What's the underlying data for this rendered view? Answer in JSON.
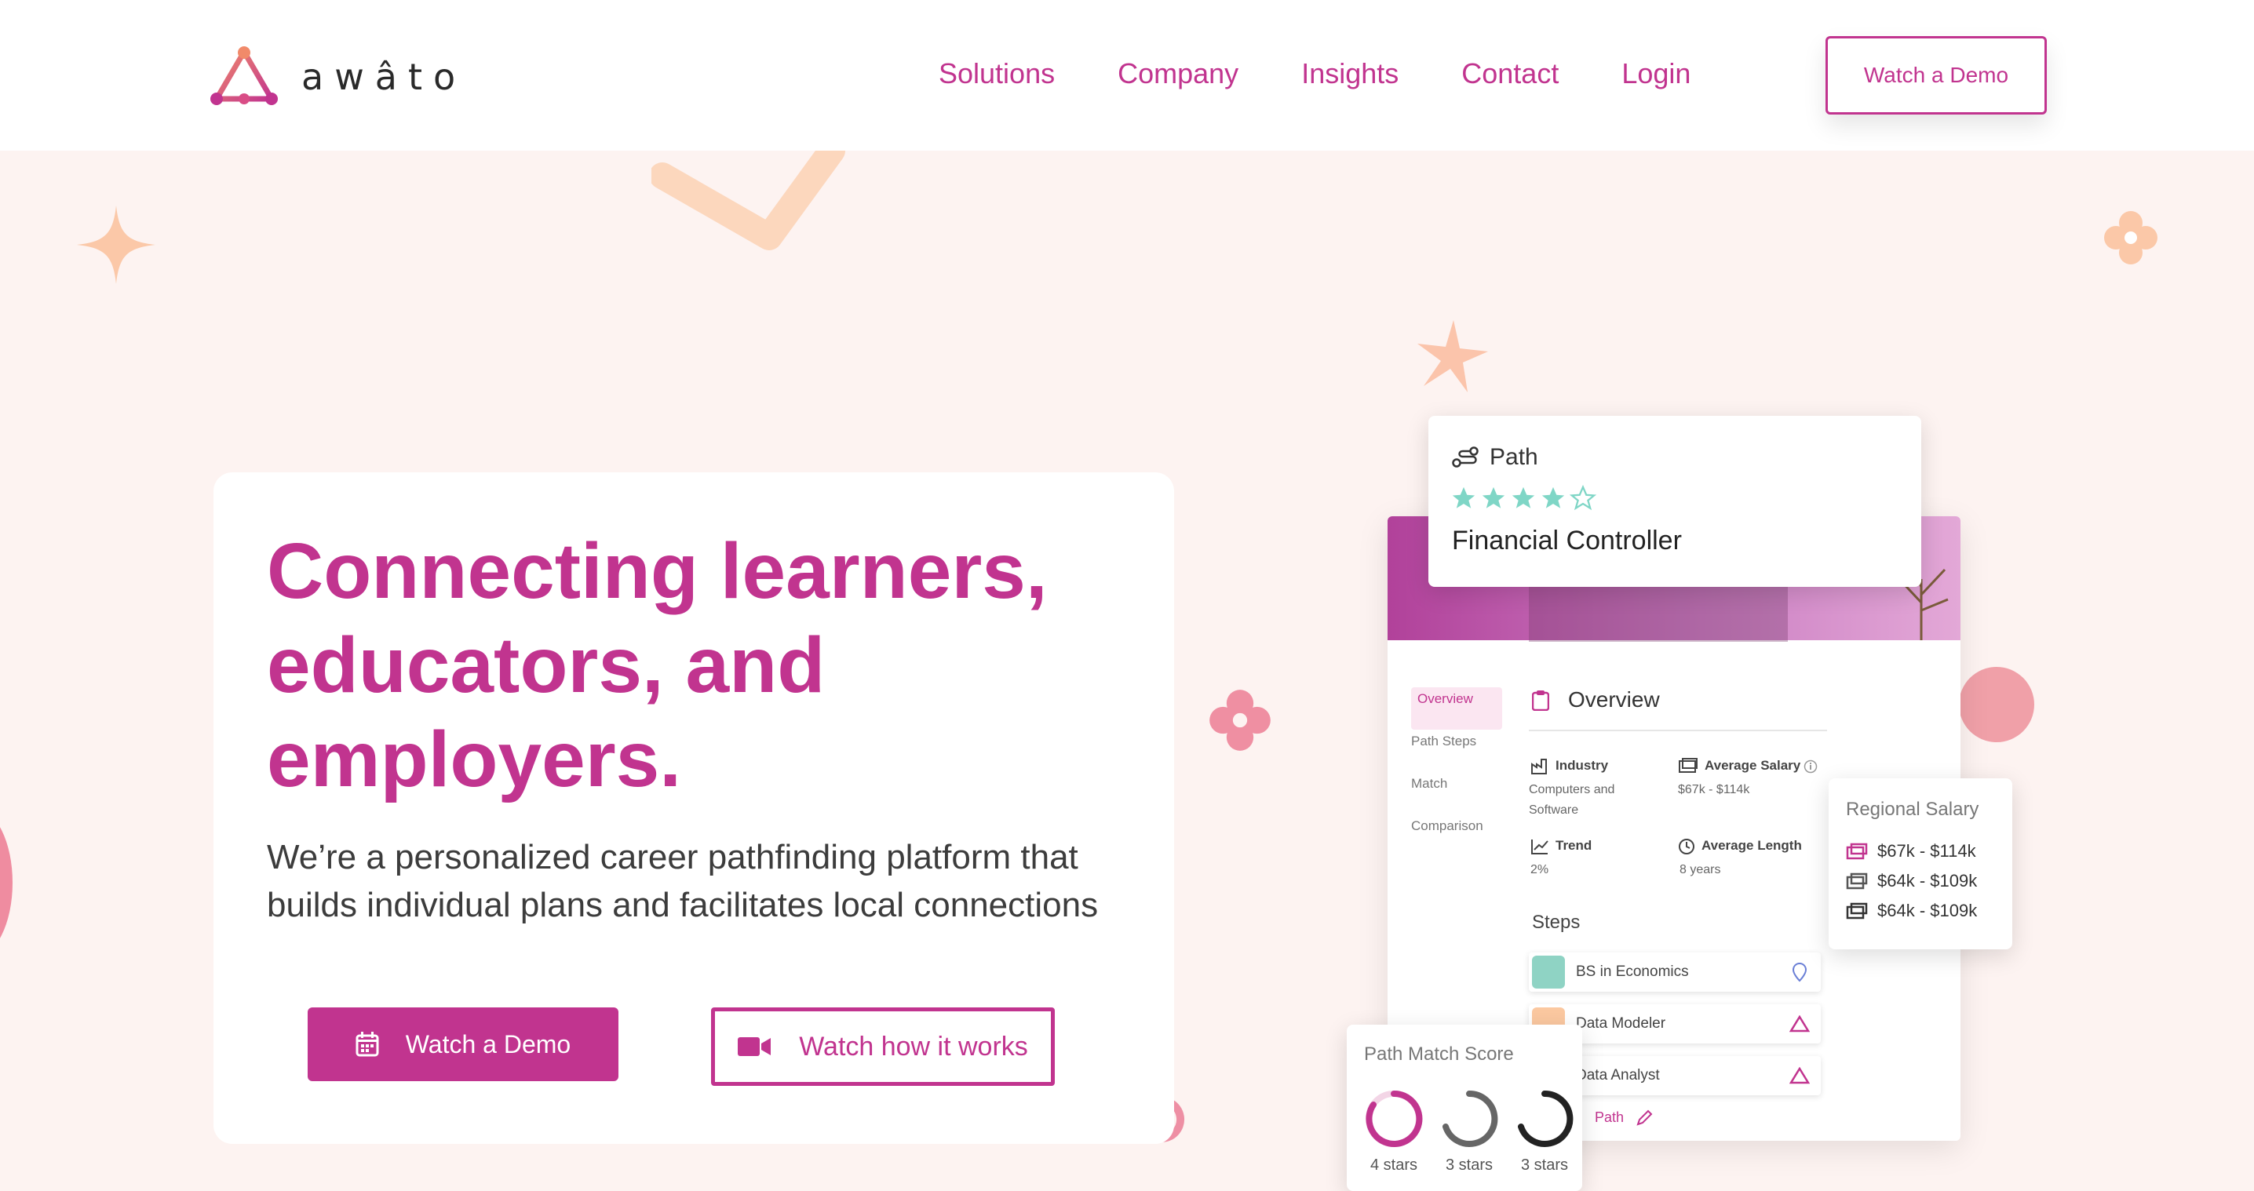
{
  "header": {
    "brand": "awâto",
    "nav": [
      {
        "label": "Solutions"
      },
      {
        "label": "Company"
      },
      {
        "label": "Insights"
      },
      {
        "label": "Contact"
      },
      {
        "label": "Login"
      }
    ],
    "demo_button": "Watch a Demo"
  },
  "hero": {
    "title_lines": [
      "Connecting learners,",
      "educators, and",
      "employers."
    ],
    "subtitle_lines": [
      "We’re a personalized career pathfinding platform that",
      "builds individual plans and facilitates local connections"
    ],
    "primary_button": "Watch a Demo",
    "secondary_button": "Watch how it works"
  },
  "mockup": {
    "path_card": {
      "label": "Path",
      "role": "Financial Controller",
      "rating": 4,
      "max_rating": 5
    },
    "sidebar": [
      "Overview",
      "Path Steps",
      "Match",
      "Comparison"
    ],
    "overview_title": "Overview",
    "industry": {
      "label": "Industry",
      "value_lines": [
        "Computers and",
        "Software"
      ]
    },
    "salary": {
      "label": "Average Salary",
      "value": "$67k - $114k"
    },
    "trend": {
      "label": "Trend",
      "value": "2%"
    },
    "length": {
      "label": "Average Length",
      "value": "8 years"
    },
    "steps_title": "Steps",
    "steps": [
      "BS in Economics",
      "Data Modeler",
      "Data Analyst"
    ],
    "path_link": "Path",
    "regional_salary": {
      "title": "Regional Salary",
      "rows": [
        "$67k - $114k",
        "$64k - $109k",
        "$64k - $109k"
      ]
    },
    "match_score": {
      "title": "Path Match Score",
      "items": [
        {
          "label": "4 stars",
          "color": "#c1348f"
        },
        {
          "label": "3 stars",
          "color": "#666666"
        },
        {
          "label": "3 stars",
          "color": "#222222"
        }
      ]
    }
  },
  "colors": {
    "brand": "#c1348f",
    "teal_star": "#7fd6c6",
    "peach": "#fbc8a8"
  }
}
